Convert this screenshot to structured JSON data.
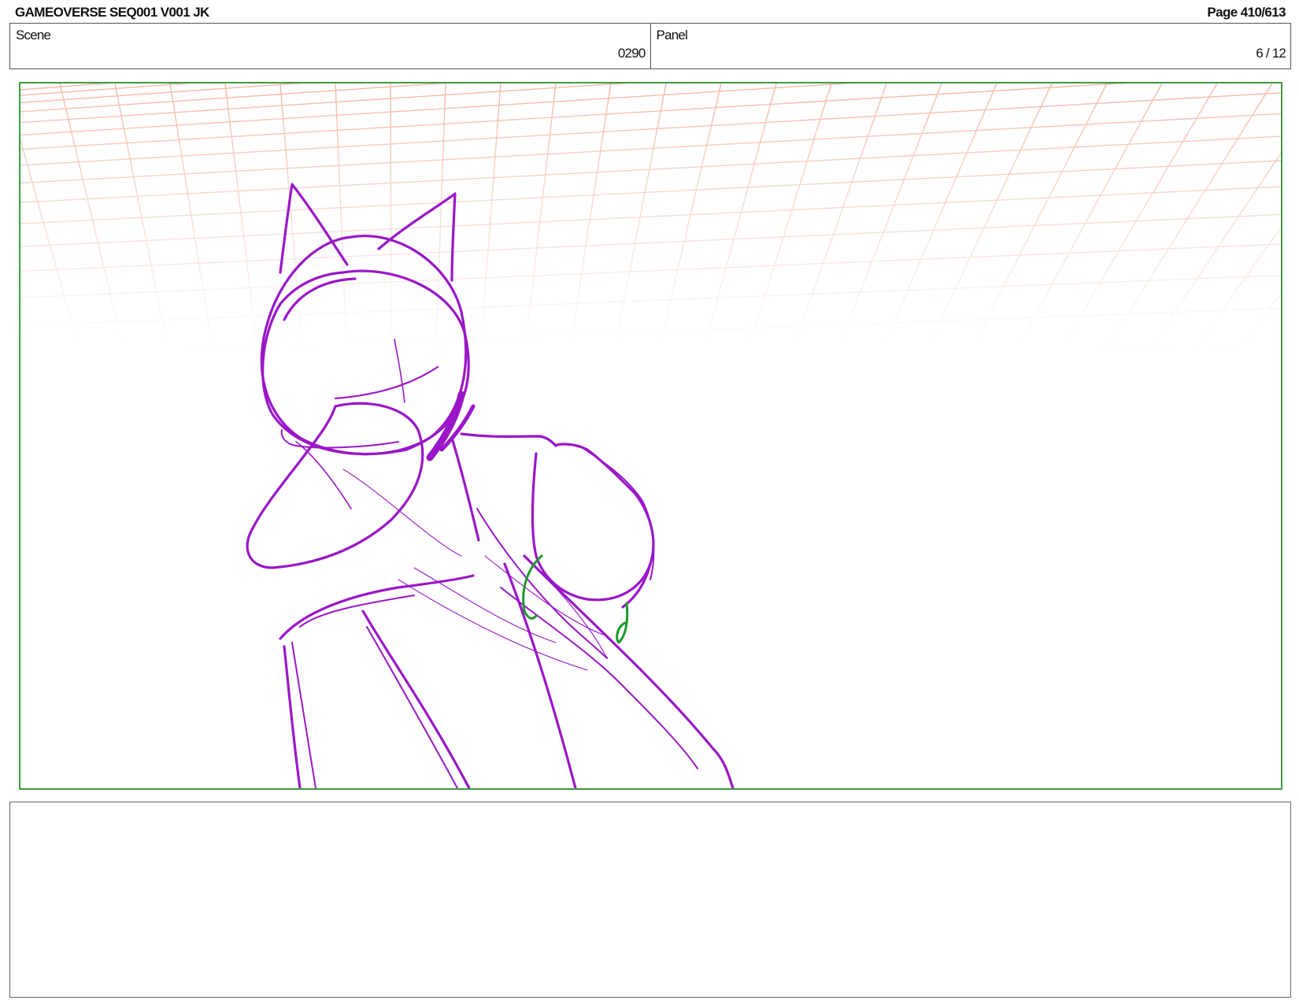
{
  "header": {
    "project_title": "GAMEOVERSE SEQ001 V001 JK",
    "page_number": "Page 410/613"
  },
  "info": {
    "scene_label": "Scene",
    "scene_value": "0290",
    "panel_label": "Panel",
    "panel_value": "6 / 12"
  },
  "panel": {
    "frame_color": "#3e9b3e",
    "sketch_color": "#9a16c8",
    "accent_sketch_color": "#1c9a2c",
    "grid_color": "#f5b8a8"
  },
  "notes": {
    "text": ""
  }
}
